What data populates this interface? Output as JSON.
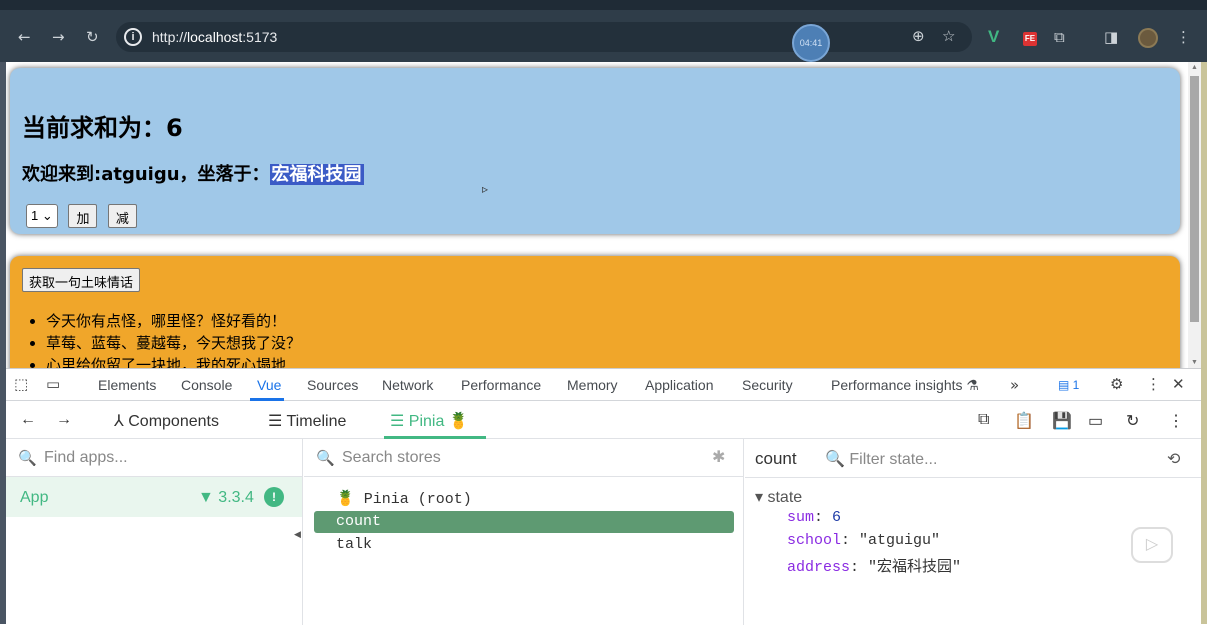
{
  "browser": {
    "url_prefix": "http://",
    "url_host": "localhost",
    "url_port": ":5173",
    "timer_text": "04:41",
    "ext_fe": "FE",
    "ext_v": "V"
  },
  "page": {
    "sum_label": "当前求和为：6",
    "welcome_prefix": "欢迎来到:atguigu，坐落于：",
    "address_highlight": "宏福科技园",
    "select_value": "1",
    "add_label": "加",
    "sub_label": "减",
    "talk_button": "获取一句土味情话",
    "talks": [
      "今天你有点怪，哪里怪？怪好看的！",
      "草莓、蓝莓、蔓越莓，今天想我了没？",
      "心里给你留了一块地，我的死心塌地"
    ]
  },
  "devtools": {
    "tabs": [
      "Elements",
      "Console",
      "Vue",
      "Sources",
      "Network",
      "Performance",
      "Memory",
      "Application",
      "Security",
      "Performance insights"
    ],
    "active_tab": "Vue",
    "issues_count": "1",
    "vue_bar": {
      "components": "Components",
      "timeline": "Timeline",
      "pinia": "Pinia"
    },
    "apps": {
      "search_placeholder": "Find apps...",
      "app_name": "App",
      "vue_version": "3.3.4"
    },
    "stores": {
      "search_placeholder": "Search stores",
      "items": [
        "Pinia (root)",
        "count",
        "talk"
      ],
      "selected": "count"
    },
    "state": {
      "store_name": "count",
      "filter_placeholder": "Filter state...",
      "section": "state",
      "entries": [
        {
          "key": "sum",
          "value": "6"
        },
        {
          "key": "school",
          "value": "\"atguigu\""
        },
        {
          "key": "address",
          "value": "\"宏福科技园\""
        }
      ]
    }
  }
}
